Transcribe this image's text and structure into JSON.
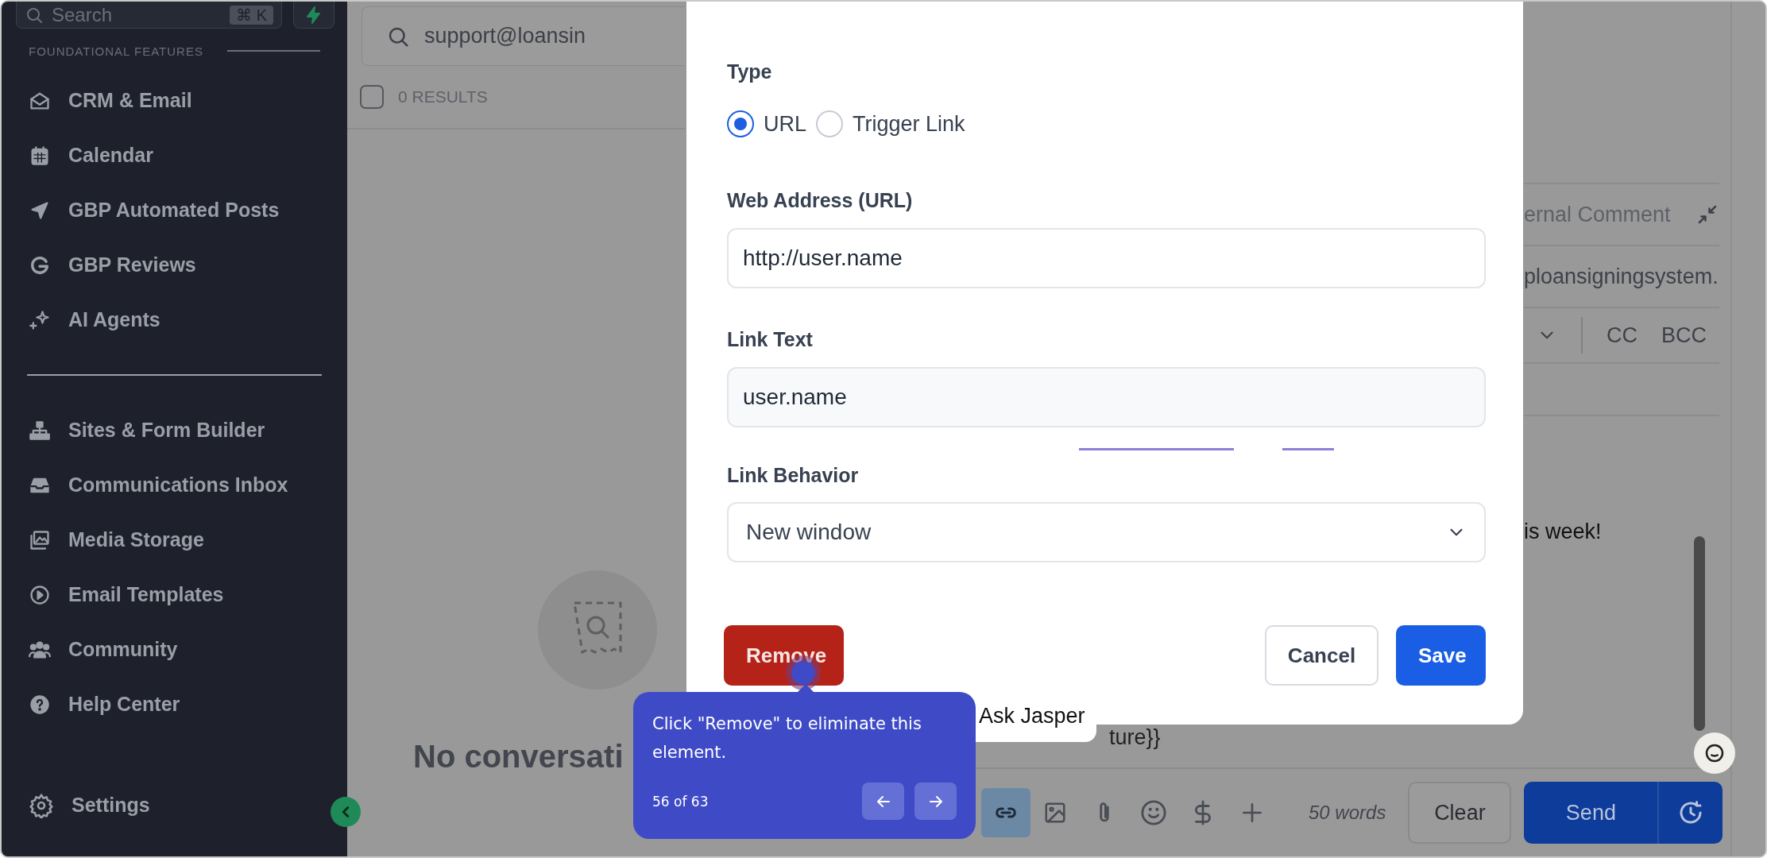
{
  "sidebar": {
    "search": {
      "placeholder": "Search",
      "shortcut": "⌘ K"
    },
    "section_label": "FOUNDATIONAL FEATURES",
    "groups": [
      [
        {
          "label": "CRM & Email"
        },
        {
          "label": "Calendar"
        },
        {
          "label": "GBP Automated Posts"
        },
        {
          "label": "GBP Reviews"
        },
        {
          "label": "AI Agents"
        }
      ],
      [
        {
          "label": "Sites & Form Builder"
        },
        {
          "label": "Communications Inbox"
        },
        {
          "label": "Media Storage"
        },
        {
          "label": "Email Templates"
        },
        {
          "label": "Community"
        },
        {
          "label": "Help Center"
        }
      ]
    ],
    "settings": "Settings"
  },
  "inbox": {
    "search_value": "support@loansin",
    "select_all_checked": false,
    "results": "0 RESULTS",
    "empty_title": "No conversati"
  },
  "composer": {
    "mode_label": "ernal Comment",
    "to_value": "ploansigningsystem.",
    "cc": "CC",
    "bcc": "BCC",
    "body_text": "is week!",
    "signature_text": "ture}}",
    "tools": [
      {
        "selected": true
      },
      {
        "selected": false
      },
      {
        "selected": false
      },
      {
        "selected": false
      },
      {
        "selected": false
      },
      {
        "selected": false
      }
    ],
    "word_count": "50 words",
    "clear": "Clear",
    "send": "Send"
  },
  "ask_jasper": "Ask Jasper",
  "modal": {
    "type_label": "Type",
    "type_options": [
      {
        "label": "URL",
        "selected": true
      },
      {
        "label": "Trigger Link",
        "selected": false
      }
    ],
    "url_label": "Web Address (URL)",
    "url_value": "http://user.name",
    "text_label": "Link Text",
    "text_value": "user.name",
    "behavior_label": "Link Behavior",
    "behavior_value": "New window",
    "remove": "Remove",
    "cancel": "Cancel",
    "save": "Save"
  },
  "tour": {
    "text": "Click \"Remove\" to eliminate this element.",
    "progress": "56 of 63"
  }
}
